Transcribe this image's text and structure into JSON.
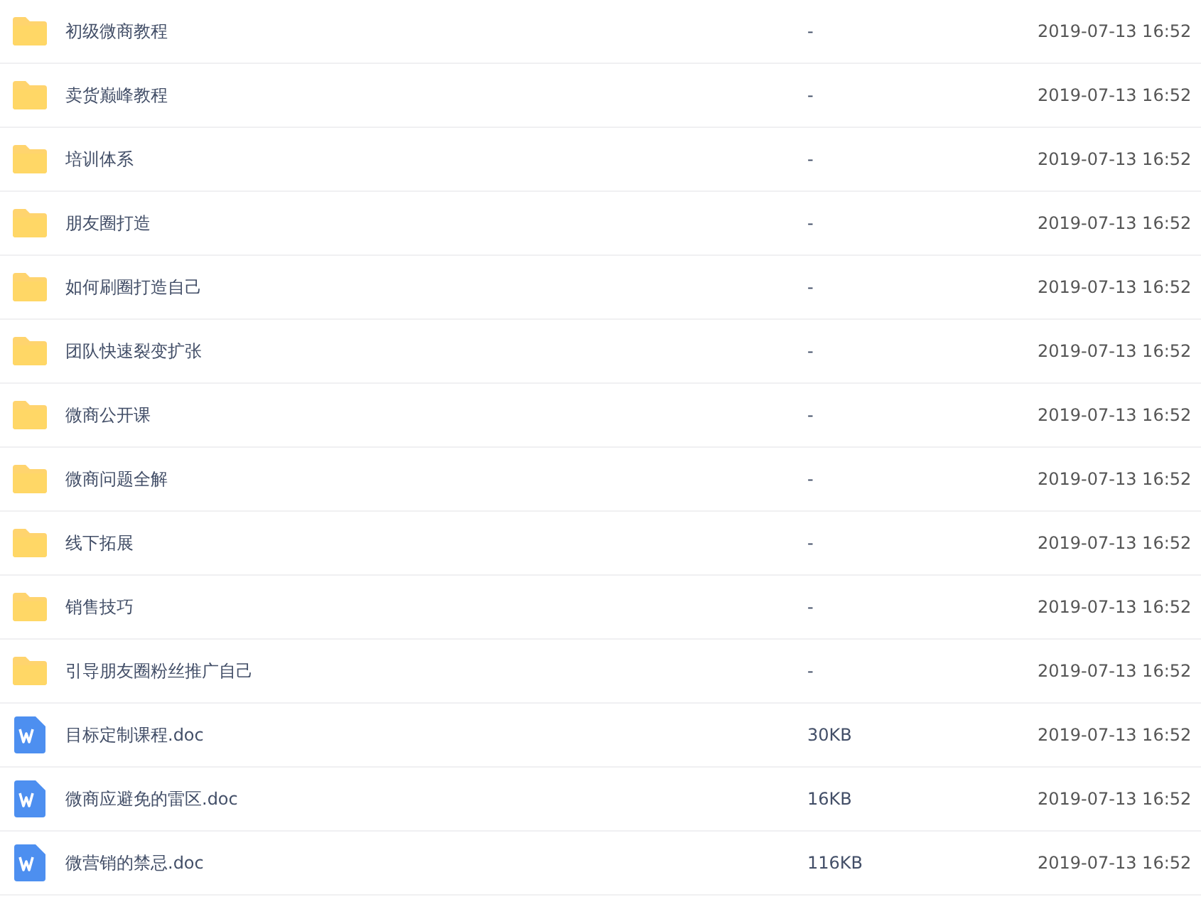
{
  "files": [
    {
      "kind": "folder",
      "name": "初级微商教程",
      "size": "-",
      "modified": "2019-07-13 16:52"
    },
    {
      "kind": "folder",
      "name": "卖货巅峰教程",
      "size": "-",
      "modified": "2019-07-13 16:52"
    },
    {
      "kind": "folder",
      "name": "培训体系",
      "size": "-",
      "modified": "2019-07-13 16:52"
    },
    {
      "kind": "folder",
      "name": "朋友圈打造",
      "size": "-",
      "modified": "2019-07-13 16:52"
    },
    {
      "kind": "folder",
      "name": "如何刷圈打造自己",
      "size": "-",
      "modified": "2019-07-13 16:52"
    },
    {
      "kind": "folder",
      "name": "团队快速裂变扩张",
      "size": "-",
      "modified": "2019-07-13 16:52"
    },
    {
      "kind": "folder",
      "name": "微商公开课",
      "size": "-",
      "modified": "2019-07-13 16:52"
    },
    {
      "kind": "folder",
      "name": "微商问题全解",
      "size": "-",
      "modified": "2019-07-13 16:52"
    },
    {
      "kind": "folder",
      "name": "线下拓展",
      "size": "-",
      "modified": "2019-07-13 16:52"
    },
    {
      "kind": "folder",
      "name": "销售技巧",
      "size": "-",
      "modified": "2019-07-13 16:52"
    },
    {
      "kind": "folder",
      "name": "引导朋友圈粉丝推广自己",
      "size": "-",
      "modified": "2019-07-13 16:52"
    },
    {
      "kind": "doc",
      "name": "目标定制课程.doc",
      "size": "30KB",
      "modified": "2019-07-13 16:52"
    },
    {
      "kind": "doc",
      "name": "微商应避免的雷区.doc",
      "size": "16KB",
      "modified": "2019-07-13 16:52"
    },
    {
      "kind": "doc",
      "name": "微营销的禁忌.doc",
      "size": "116KB",
      "modified": "2019-07-13 16:52"
    }
  ]
}
